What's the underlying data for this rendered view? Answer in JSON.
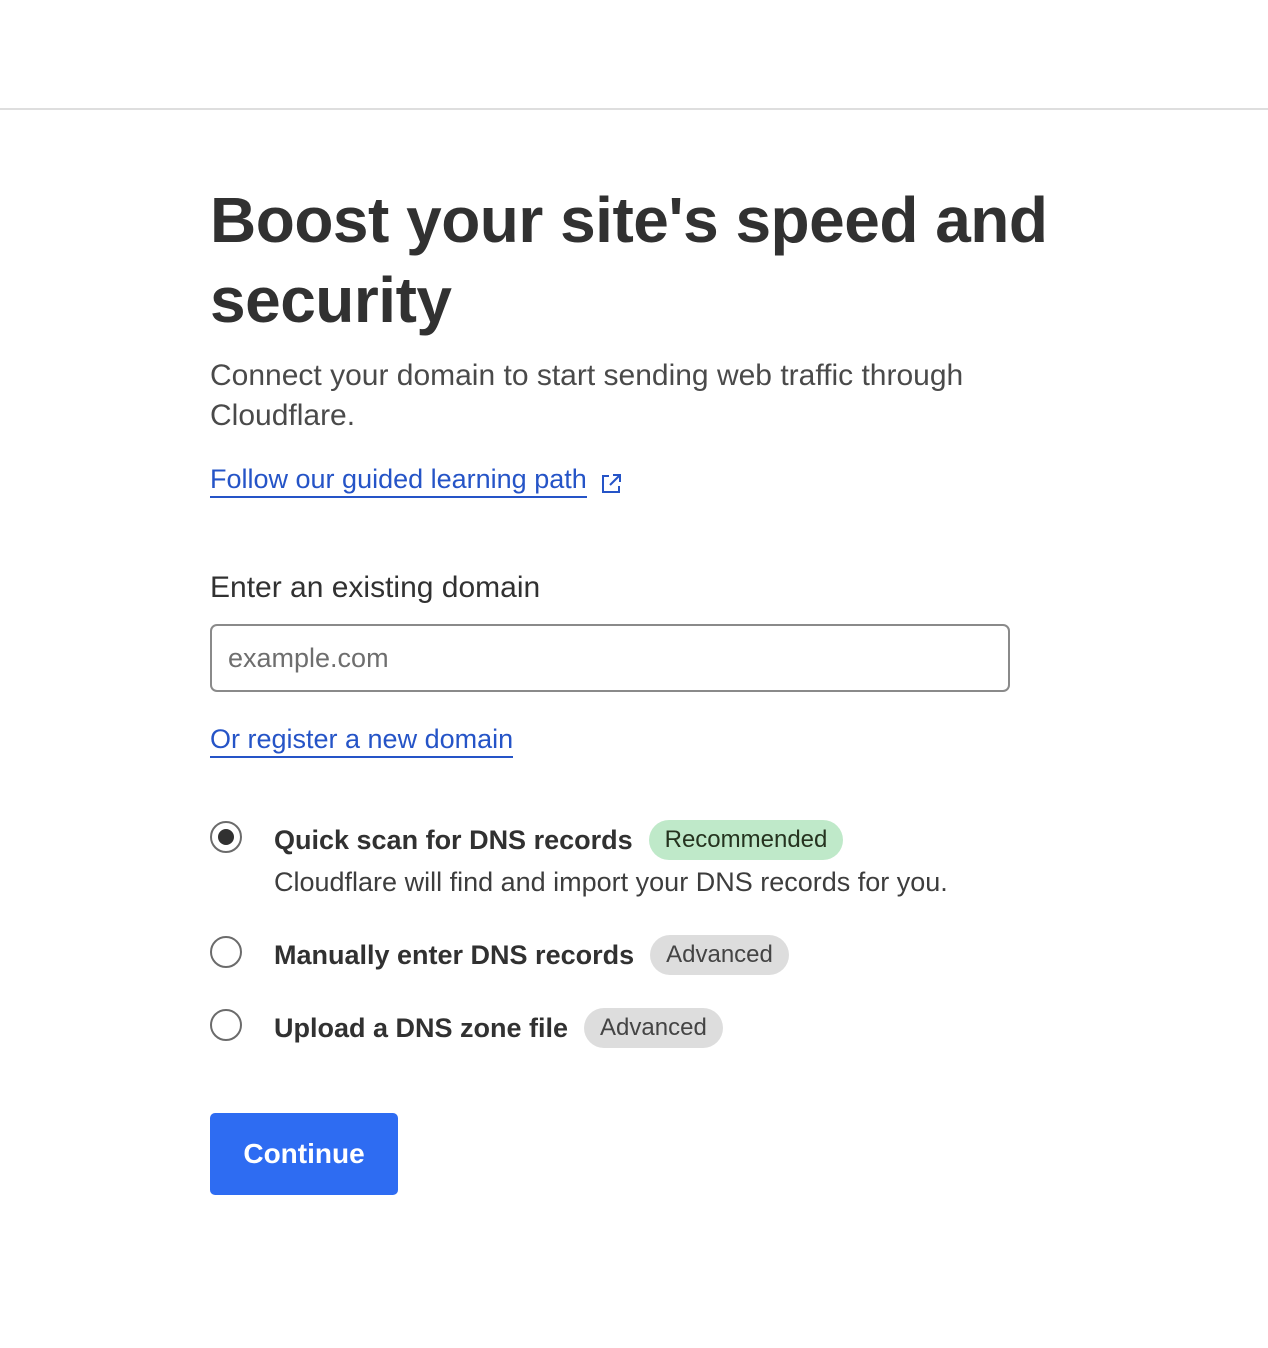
{
  "header": {},
  "page": {
    "title": "Boost your site's speed and security",
    "subtitle": "Connect your domain to start sending web traffic through Cloudflare.",
    "learning_link": "Follow our guided learning path",
    "learning_link_icon": "external-link-icon"
  },
  "domain_form": {
    "label": "Enter an existing domain",
    "input_value": "",
    "input_placeholder": "example.com",
    "register_link": "Or register a new domain"
  },
  "options": [
    {
      "title": "Quick scan for DNS records",
      "badge": "Recommended",
      "badge_color": "#bfe9c9",
      "description": "Cloudflare will find and import your DNS records for you.",
      "selected": true
    },
    {
      "title": "Manually enter DNS records",
      "badge": "Advanced",
      "badge_color": "#dddddd",
      "selected": false
    },
    {
      "title": "Upload a DNS zone file",
      "badge": "Advanced",
      "badge_color": "#dddddd",
      "selected": false
    }
  ],
  "actions": {
    "continue_label": "Continue",
    "continue_color": "#2e6cf2"
  }
}
